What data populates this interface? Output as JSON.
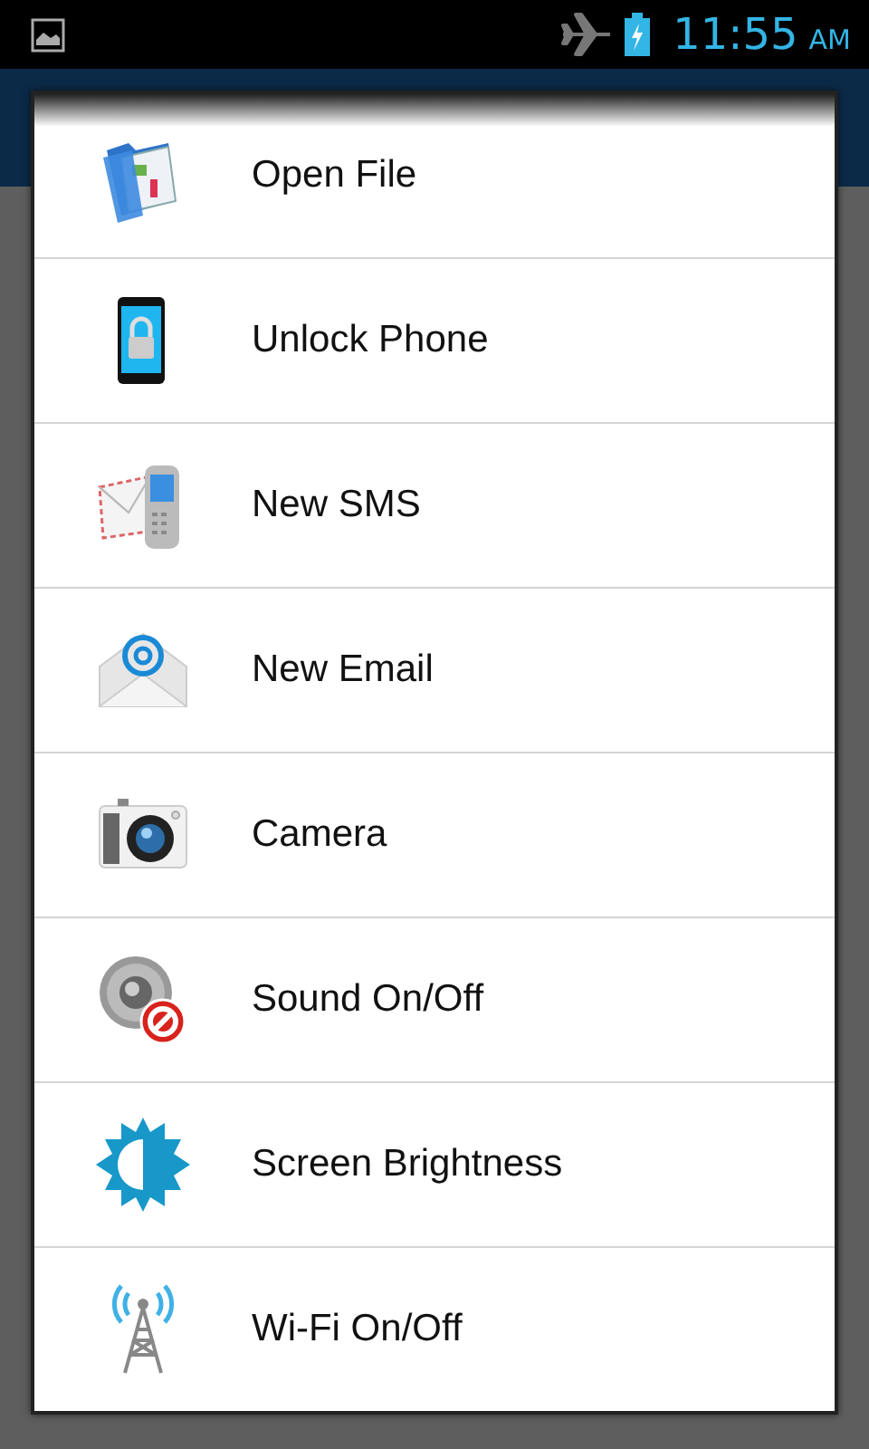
{
  "status_bar": {
    "time": "11:55",
    "meridiem": "AM"
  },
  "menu": {
    "items": [
      {
        "label": "Open File",
        "kind": "folder"
      },
      {
        "label": "Unlock Phone",
        "kind": "lock"
      },
      {
        "label": "New SMS",
        "kind": "sms"
      },
      {
        "label": "New Email",
        "kind": "email"
      },
      {
        "label": "Camera",
        "kind": "camera"
      },
      {
        "label": "Sound On/Off",
        "kind": "sound"
      },
      {
        "label": "Screen Brightness",
        "kind": "brightness"
      },
      {
        "label": "Wi-Fi On/Off",
        "kind": "wifi"
      }
    ]
  }
}
